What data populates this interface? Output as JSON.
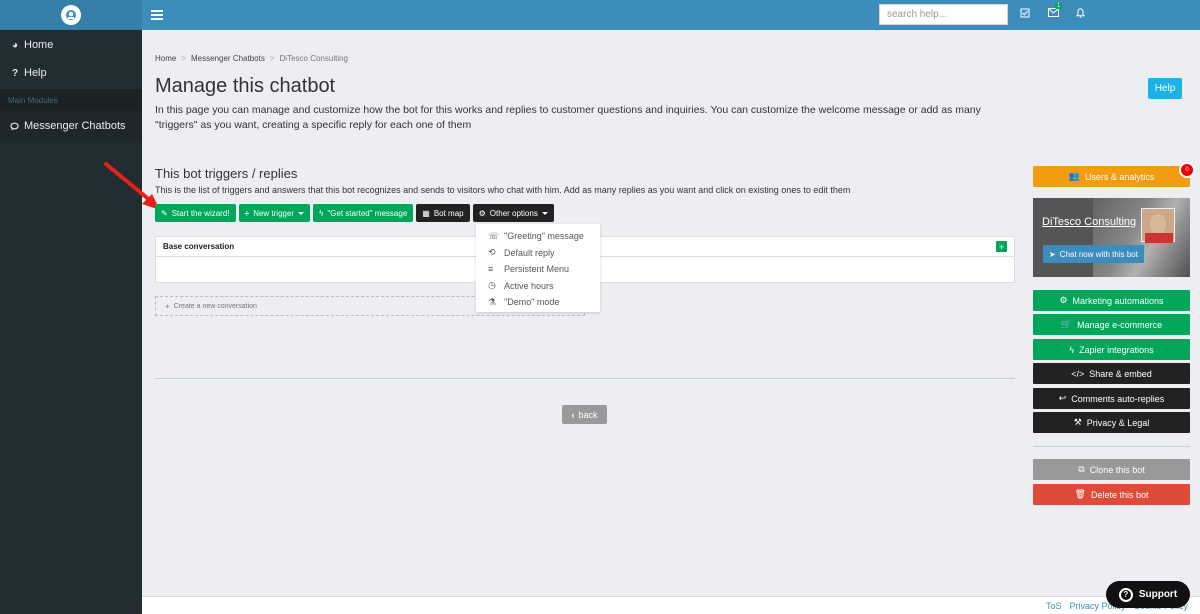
{
  "sidebar": {
    "items": [
      {
        "label": "Home",
        "icon": "dashboard-icon"
      },
      {
        "label": "Help",
        "icon": "question-icon"
      }
    ],
    "section_header": "Main Modules",
    "active_item": {
      "label": "Messenger Chatbots",
      "icon": "comments-icon"
    }
  },
  "topbar": {
    "search_placeholder": "search help...",
    "messages_badge": "1"
  },
  "breadcrumb": [
    "Home",
    "Messenger Chatbots",
    "DiTesco Consulting"
  ],
  "page": {
    "title": "Manage this chatbot",
    "help_label": "Help",
    "intro": "In this page you can manage and customize how the bot for this works and replies to customer questions and inquiries. You can customize the welcome message or add as many \"triggers\" as you want, creating a specific reply for each one of them"
  },
  "triggers": {
    "title": "This bot triggers / replies",
    "description": "This is the list of triggers and answers that this bot recognizes and sends to visitors who chat with him. Add as many replies as you want and click on existing ones to edit them",
    "buttons": {
      "wizard": "Start the wizard!",
      "new_trigger": "New trigger",
      "get_started": "\"Get started\" message",
      "bot_map": "Bot map",
      "other_options": "Other options"
    },
    "conversation_header": "Base conversation",
    "create_conversation": "Create a new conversation",
    "back": "back"
  },
  "dropdown": {
    "items": [
      {
        "label": "\"Greeting\" message",
        "icon": "greeting-icon"
      },
      {
        "label": "Default reply",
        "icon": "reply-icon"
      },
      {
        "label": "Persistent Menu",
        "icon": "menu-icon"
      },
      {
        "label": "Active hours",
        "icon": "clock-icon"
      },
      {
        "label": "\"Demo\" mode",
        "icon": "flask-icon"
      }
    ]
  },
  "right": {
    "users_analytics": "Users & analytics",
    "users_badge": "0",
    "bot_name": "DiTesco Consulting",
    "chat_now": "Chat now with this bot",
    "marketing": "Marketing automations",
    "ecommerce": "Manage e-commerce",
    "zapier": "Zapier integrations",
    "share": "Share & embed",
    "comments": "Comments auto-replies",
    "privacy": "Privacy & Legal",
    "clone": "Clone this bot",
    "delete": "Delete this bot"
  },
  "footer": {
    "links": [
      "ToS",
      "Privacy Policy",
      "Cookie Policy"
    ],
    "support": "Support"
  },
  "colors": {
    "topbar": "#3c8dbc",
    "sidebar": "#222d32",
    "green": "#00a65a",
    "orange": "#f39c12",
    "red": "#dd4b39",
    "dark": "#222222"
  }
}
